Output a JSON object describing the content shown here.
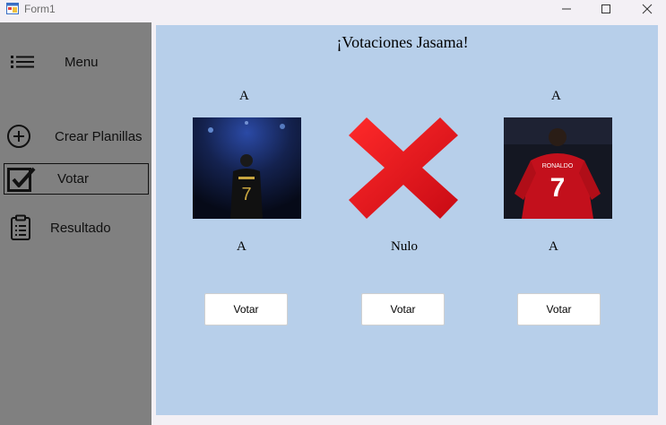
{
  "window": {
    "title": "Form1",
    "icons": [
      "app-icon",
      "minimize-icon",
      "maximize-icon",
      "close-icon"
    ]
  },
  "sidebar": {
    "menu_label": "Menu",
    "items": [
      {
        "label": "Crear Planillas",
        "icon": "add-circle-icon"
      },
      {
        "label": "Votar",
        "icon": "checkbox-icon",
        "selected": true
      },
      {
        "label": "Resultado",
        "icon": "clipboard-icon"
      }
    ]
  },
  "main": {
    "heading": "¡Votaciones Jasama!",
    "candidates": [
      {
        "top_label": "A",
        "bottom_label": "A",
        "image": "player-photo-back-dark-jersey",
        "button": "Votar"
      },
      {
        "top_label": "",
        "bottom_label": "Nulo",
        "image": "red-x-icon",
        "button": "Votar"
      },
      {
        "top_label": "A",
        "bottom_label": "A",
        "image": "player-photo-back-red-jersey",
        "button": "Votar"
      }
    ]
  },
  "colors": {
    "sidebar_bg": "#808080",
    "main_bg": "#b7cfea",
    "window_bg": "#f3f0f5",
    "nulo_red": "#e0141c"
  }
}
